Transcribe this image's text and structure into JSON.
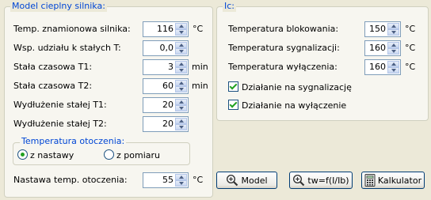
{
  "left_panel": {
    "title": "Model cieplny silnika:",
    "fields": [
      {
        "label": "Temp. znamionowa silnika:",
        "value": "116",
        "unit": "°C"
      },
      {
        "label": "Wsp. udziału k stałych T:",
        "value": "0,0",
        "unit": ""
      },
      {
        "label": "Stała czasowa T1:",
        "value": "3",
        "unit": "min"
      },
      {
        "label": "Stała czasowa T2:",
        "value": "60",
        "unit": "min"
      },
      {
        "label": "Wydłużenie stałej T1:",
        "value": "20",
        "unit": ""
      },
      {
        "label": "Wydłużenie stałej T2:",
        "value": "20",
        "unit": ""
      }
    ],
    "ambient_group": {
      "title": "Temperatura otoczenia:",
      "options": [
        {
          "label": "z nastawy",
          "selected": true
        },
        {
          "label": "z pomiaru",
          "selected": false
        }
      ]
    },
    "ambient_setting": {
      "label": "Nastawa temp. otoczenia:",
      "value": "55",
      "unit": "°C"
    }
  },
  "right_panel": {
    "title": "Ic:",
    "fields": [
      {
        "label": "Temperatura blokowania:",
        "value": "150",
        "unit": "°C"
      },
      {
        "label": "Temperatura sygnalizacji:",
        "value": "160",
        "unit": "°C"
      },
      {
        "label": "Temperatura wyłączenia:",
        "value": "160",
        "unit": "°C"
      }
    ],
    "checkboxes": [
      {
        "label": "Działanie na sygnalizację",
        "checked": true
      },
      {
        "label": "Działanie na wyłączenie",
        "checked": true
      }
    ]
  },
  "buttons": {
    "model": "Model",
    "tw": "tw=f(I/Ib)",
    "calc": "Kalkulator"
  }
}
